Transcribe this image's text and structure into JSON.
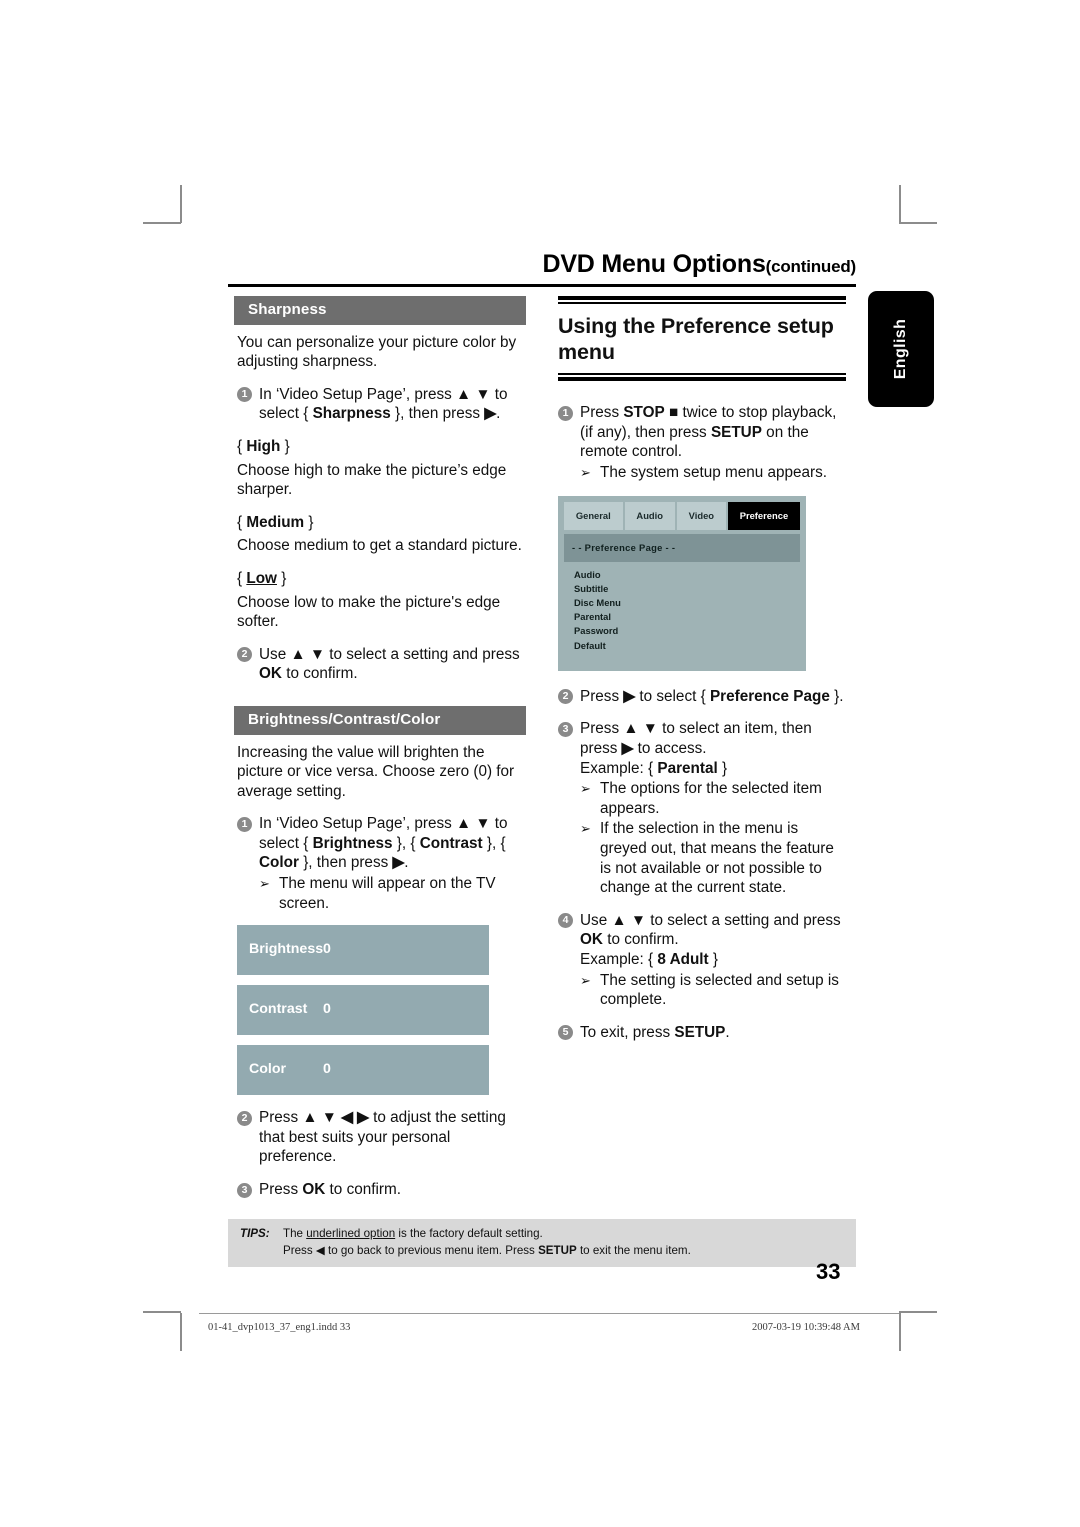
{
  "header": {
    "title": "DVD Menu Options",
    "continued": "(continued)"
  },
  "language_tab": {
    "label": "English"
  },
  "left_column": {
    "sharpness": {
      "heading": "Sharpness",
      "intro": "You can personalize your picture color by adjusting sharpness.",
      "step1_num": "1",
      "step1_a": "In ‘Video Setup Page’, press ",
      "step1_b": "▲ ▼",
      "step1_c": " to select { ",
      "step1_d": "Sharpness",
      "step1_e": " }, then press ",
      "step1_f": "▶",
      "step1_g": ".",
      "options": [
        {
          "name": "High",
          "underlined": false,
          "desc": "Choose high to make the picture’s edge sharper."
        },
        {
          "name": "Medium",
          "underlined": false,
          "desc": "Choose medium to get a standard picture."
        },
        {
          "name": "Low",
          "underlined": true,
          "desc": "Choose low to make the picture's edge softer."
        }
      ],
      "step2_num": "2",
      "step2_a": "Use ",
      "step2_b": "▲ ▼",
      "step2_c": " to select a setting and press ",
      "step2_d": "OK",
      "step2_e": " to confirm."
    },
    "bcc": {
      "heading": "Brightness/Contrast/Color",
      "intro": "Increasing the value will brighten the picture or vice versa. Choose zero (0) for average setting.",
      "step1_num": "1",
      "step1_a": "In ‘Video Setup Page’, press ",
      "step1_b": "▲ ▼",
      "step1_c": " to select { ",
      "step1_d": "Brightness",
      "step1_e": " }, { ",
      "step1_f": "Contrast",
      "step1_g": " }, { ",
      "step1_h": "Color",
      "step1_i": " }, then press ",
      "step1_j": "▶",
      "step1_k": ".",
      "step1_sub": "The menu will appear on the TV screen.",
      "value_boxes": [
        {
          "label": "Brightness",
          "value": "0"
        },
        {
          "label": "Contrast",
          "value": "0"
        },
        {
          "label": "Color",
          "value": "0"
        }
      ],
      "step2_num": "2",
      "step2_a": "Press ",
      "step2_b": "▲ ▼ ◀ ▶",
      "step2_c": " to adjust the setting that best suits your personal preference.",
      "step3_num": "3",
      "step3_a": "Press ",
      "step3_b": "OK",
      "step3_c": " to confirm."
    }
  },
  "right_column": {
    "heading": "Using the Preference setup menu",
    "step1_num": "1",
    "step1_a": "Press ",
    "step1_b": "STOP",
    "step1_c": " ■ ",
    "step1_d": "twice to stop playback, (if any), then press ",
    "step1_e": "SETUP",
    "step1_f": " on the remote control.",
    "step1_sub": "The system setup menu appears.",
    "osd": {
      "tabs": [
        {
          "label": "General",
          "active": false
        },
        {
          "label": "Audio",
          "active": false
        },
        {
          "label": "Video",
          "active": false
        },
        {
          "label": "Preference",
          "active": true
        }
      ],
      "page_bar": "- -  Preference Page  - -",
      "items": [
        "Audio",
        "Subtitle",
        "Disc Menu",
        "Parental",
        "Password",
        "Default"
      ]
    },
    "step2_num": "2",
    "step2_a": "Press ",
    "step2_b": "▶",
    "step2_c": " to select { ",
    "step2_d": "Preference Page",
    "step2_e": " }.",
    "step3_num": "3",
    "step3_a": "Press ",
    "step3_b": "▲ ▼",
    "step3_c": " to select an item, then press ",
    "step3_d": "▶",
    "step3_e": " to access.",
    "step3_example_a": "Example: { ",
    "step3_example_b": "Parental",
    "step3_example_c": " }",
    "step3_sub1": "The options for the selected item appears.",
    "step3_sub2": "If the selection in the menu is greyed out, that means the feature is not available or not possible to change at the current state.",
    "step4_num": "4",
    "step4_a": "Use ",
    "step4_b": "▲ ▼",
    "step4_c": " to select a setting and press ",
    "step4_d": "OK",
    "step4_e": " to confirm.",
    "step4_example_a": "Example: { ",
    "step4_example_b": "8 Adult",
    "step4_example_c": " }",
    "step4_sub": "The setting is selected and setup is complete.",
    "step5_num": "5",
    "step5_a": "To exit, press ",
    "step5_b": "SETUP",
    "step5_c": "."
  },
  "tips": {
    "label": "TIPS:",
    "line1_a": "The ",
    "line1_b": "underlined option",
    "line1_c": " is the factory default setting.",
    "line2_a": "Press  ",
    "line2_b": "◀",
    "line2_c": " to go back to previous menu item. Press ",
    "line2_d": "SETUP",
    "line2_e": " to exit the menu item."
  },
  "page_number": "33",
  "print_footer": {
    "file": "01-41_dvp1013_37_eng1.indd   33",
    "date": "2007-03-19   10:39:48 AM"
  },
  "colors": {
    "section_bar": "#6e6e6e",
    "value_box": "#93aab0",
    "osd_bg": "#9fb3b5",
    "osd_tab": "#bcccce",
    "osd_pagebar": "#7e9396",
    "tips_band": "#d8d8d8",
    "step_bullet": "#8a8a8a"
  }
}
